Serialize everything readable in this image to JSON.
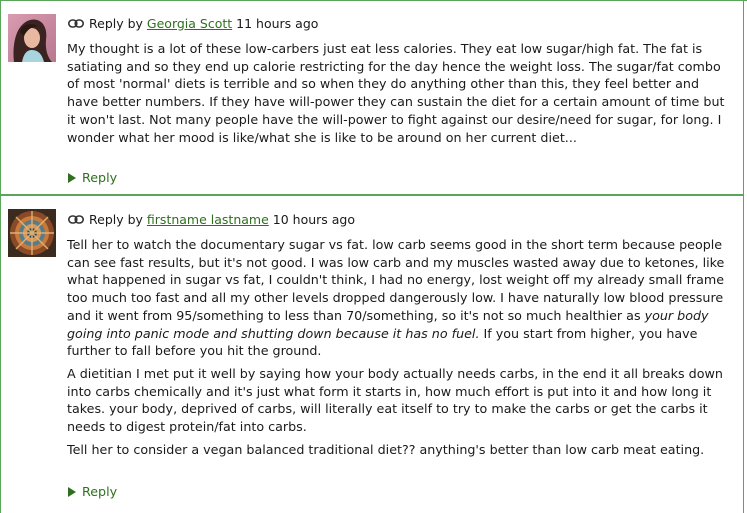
{
  "comments": [
    {
      "reply_prefix": "Reply by",
      "author": "Georgia Scott",
      "time": "11 hours ago",
      "paragraphs": [
        "My thought is a lot of these low-carbers just eat less calories. They eat low sugar/high fat. The fat is satiating and so they end up calorie restricting for the day hence the weight loss. The sugar/fat combo of most 'normal' diets is terrible and so when they do anything other than this, they feel better and have better numbers. If they have will-power they can sustain the diet for a certain amount of time but it won't last. Not many people have the will-power to fight against our desire/need for sugar, for long. I wonder what her mood is like/what she is like to be around on her current diet..."
      ],
      "reply_label": "Reply"
    },
    {
      "reply_prefix": "Reply by",
      "author": "firstname lastname",
      "time": "10 hours ago",
      "p1_a": "Tell her to watch the documentary sugar vs fat. low carb seems good in the short term because people can see fast results, but it's not good. I was low carb and my muscles wasted away due to ketones, like what happened in sugar vs fat, I couldn't think, I had no energy, lost weight off my already small frame too much too fast and all my other levels dropped dangerously low. I have naturally low blood pressure and it went from 95/something to less than  70/something, so it's not so much healthier as ",
      "p1_em": "your body going into panic mode and shutting down because it has no fuel.",
      "p1_b": " If you start from higher, you have further to fall before you hit the ground.",
      "p2": "A dietitian I met put it well by saying how your body actually needs carbs, in the end it all breaks down into carbs chemically and it's just what form it starts in, how much effort is put into it and how long it takes. your body, deprived of carbs, will literally eat itself to try to make the carbs or get the carbs it needs to digest protein/fat into carbs.",
      "p3": "Tell her to consider a vegan balanced traditional diet?? anything's better than low carb meat eating.",
      "reply_label": "Reply"
    }
  ],
  "colors": {
    "accent_green": "#2f6f1f",
    "border_green": "#5aa55a"
  }
}
